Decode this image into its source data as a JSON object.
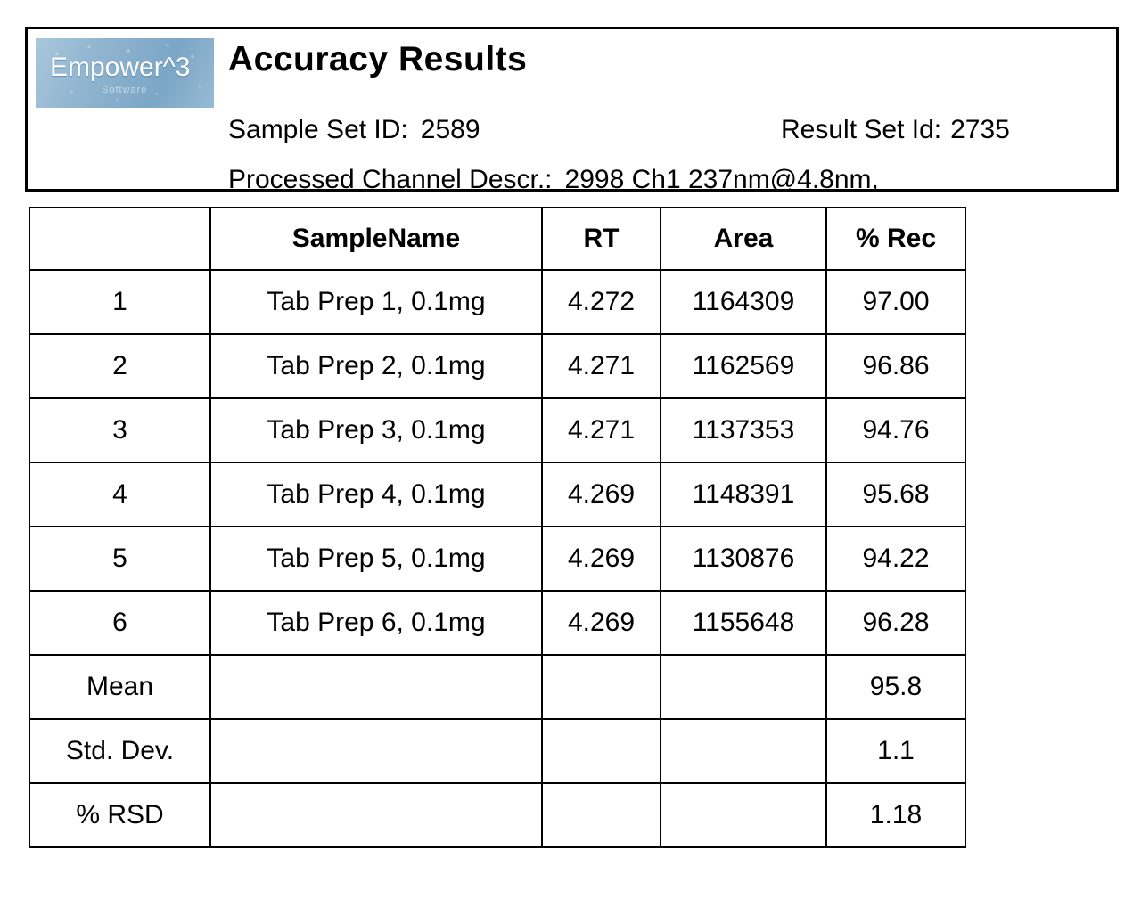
{
  "header": {
    "logo": {
      "wordmark": "Empower^3",
      "subcaption": "Software",
      "background_color": "#8fb4cf"
    },
    "title": "Accuracy Results",
    "meta": {
      "sample_set_id_label": "Sample Set ID:",
      "sample_set_id_value": "2589",
      "result_set_id_label": "Result Set Id:",
      "result_set_id_value": "2735",
      "processed_channel_label": "Processed Channel Descr.:",
      "processed_channel_value": "2998 Ch1 237nm@4.8nm,"
    }
  },
  "table": {
    "columns": [
      "",
      "SampleName",
      "RT",
      "Area",
      "% Rec"
    ],
    "rows": [
      {
        "index": "1",
        "sample_name": "Tab Prep 1, 0.1mg",
        "rt": "4.272",
        "area": "1164309",
        "rec": "97.00"
      },
      {
        "index": "2",
        "sample_name": "Tab Prep 2, 0.1mg",
        "rt": "4.271",
        "area": "1162569",
        "rec": "96.86"
      },
      {
        "index": "3",
        "sample_name": "Tab Prep 3, 0.1mg",
        "rt": "4.271",
        "area": "1137353",
        "rec": "94.76"
      },
      {
        "index": "4",
        "sample_name": "Tab Prep 4, 0.1mg",
        "rt": "4.269",
        "area": "1148391",
        "rec": "95.68"
      },
      {
        "index": "5",
        "sample_name": "Tab Prep 5, 0.1mg",
        "rt": "4.269",
        "area": "1130876",
        "rec": "94.22"
      },
      {
        "index": "6",
        "sample_name": "Tab Prep 6, 0.1mg",
        "rt": "4.269",
        "area": "1155648",
        "rec": "96.28"
      }
    ],
    "summary": [
      {
        "index": "Mean",
        "sample_name": "",
        "rt": "",
        "area": "",
        "rec": "95.8"
      },
      {
        "index": "Std. Dev.",
        "sample_name": "",
        "rt": "",
        "area": "",
        "rec": "1.1"
      },
      {
        "index": "% RSD",
        "sample_name": "",
        "rt": "",
        "area": "",
        "rec": "1.18"
      }
    ]
  },
  "chart_data": {
    "type": "table",
    "title": "Accuracy Results",
    "columns": [
      "",
      "SampleName",
      "RT",
      "Area",
      "% Rec"
    ],
    "categories": [
      "Tab Prep 1, 0.1mg",
      "Tab Prep 2, 0.1mg",
      "Tab Prep 3, 0.1mg",
      "Tab Prep 4, 0.1mg",
      "Tab Prep 5, 0.1mg",
      "Tab Prep 6, 0.1mg"
    ],
    "series": [
      {
        "name": "RT",
        "values": [
          4.272,
          4.271,
          4.271,
          4.269,
          4.269,
          4.269
        ]
      },
      {
        "name": "Area",
        "values": [
          1164309,
          1162569,
          1137353,
          1148391,
          1130876,
          1155648
        ]
      },
      {
        "name": "% Rec",
        "values": [
          97.0,
          96.86,
          94.76,
          95.68,
          94.22,
          96.28
        ]
      }
    ],
    "statistics": {
      "mean_rec": 95.8,
      "std_dev_rec": 1.1,
      "percent_rsd_rec": 1.18
    }
  }
}
